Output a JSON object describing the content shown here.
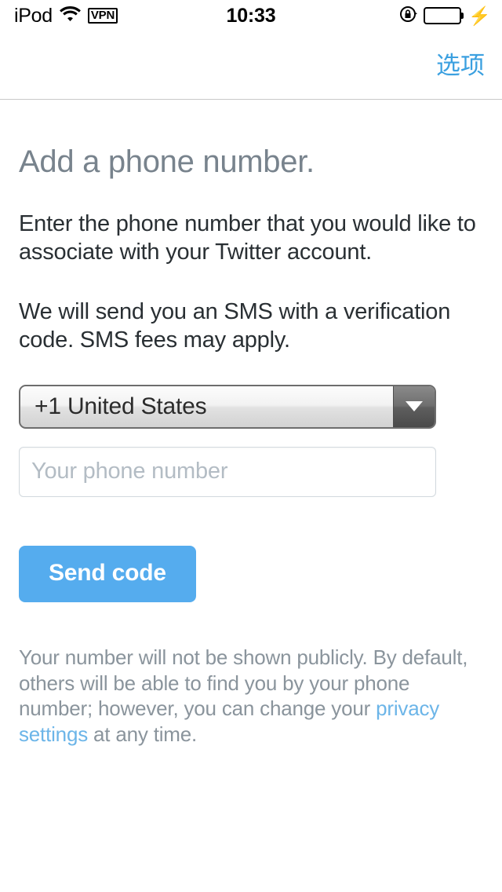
{
  "status_bar": {
    "carrier": "iPod",
    "wifi_icon": "wifi-icon",
    "vpn_label": "VPN",
    "time": "10:33",
    "rotation_lock_icon": "rotation-lock-icon",
    "battery_icon": "battery-icon",
    "charging_icon": "lightning-bolt-icon",
    "battery_color": "#34ce4b"
  },
  "nav_bar": {
    "action_label": "选项",
    "action_color": "#3ba0e0"
  },
  "main": {
    "title": "Add a phone number.",
    "paragraph_1": "Enter the phone number that you would like to associate with your Twitter account.",
    "paragraph_2": "We will send you an SMS with a verification code. SMS fees may apply.",
    "country_select": {
      "selected": "+1 United States",
      "arrow_icon": "chevron-down-icon"
    },
    "phone_field": {
      "value": "",
      "placeholder": "Your phone number"
    },
    "send_button": {
      "label": "Send code",
      "color": "#55acee"
    },
    "footer": {
      "text_before_link": "Your number will not be shown publicly. By default, others will be able to find you by your phone number; however, you can change your ",
      "link_text": "privacy settings",
      "text_after_link": " at any time.",
      "link_color": "#6cb5e8"
    }
  }
}
